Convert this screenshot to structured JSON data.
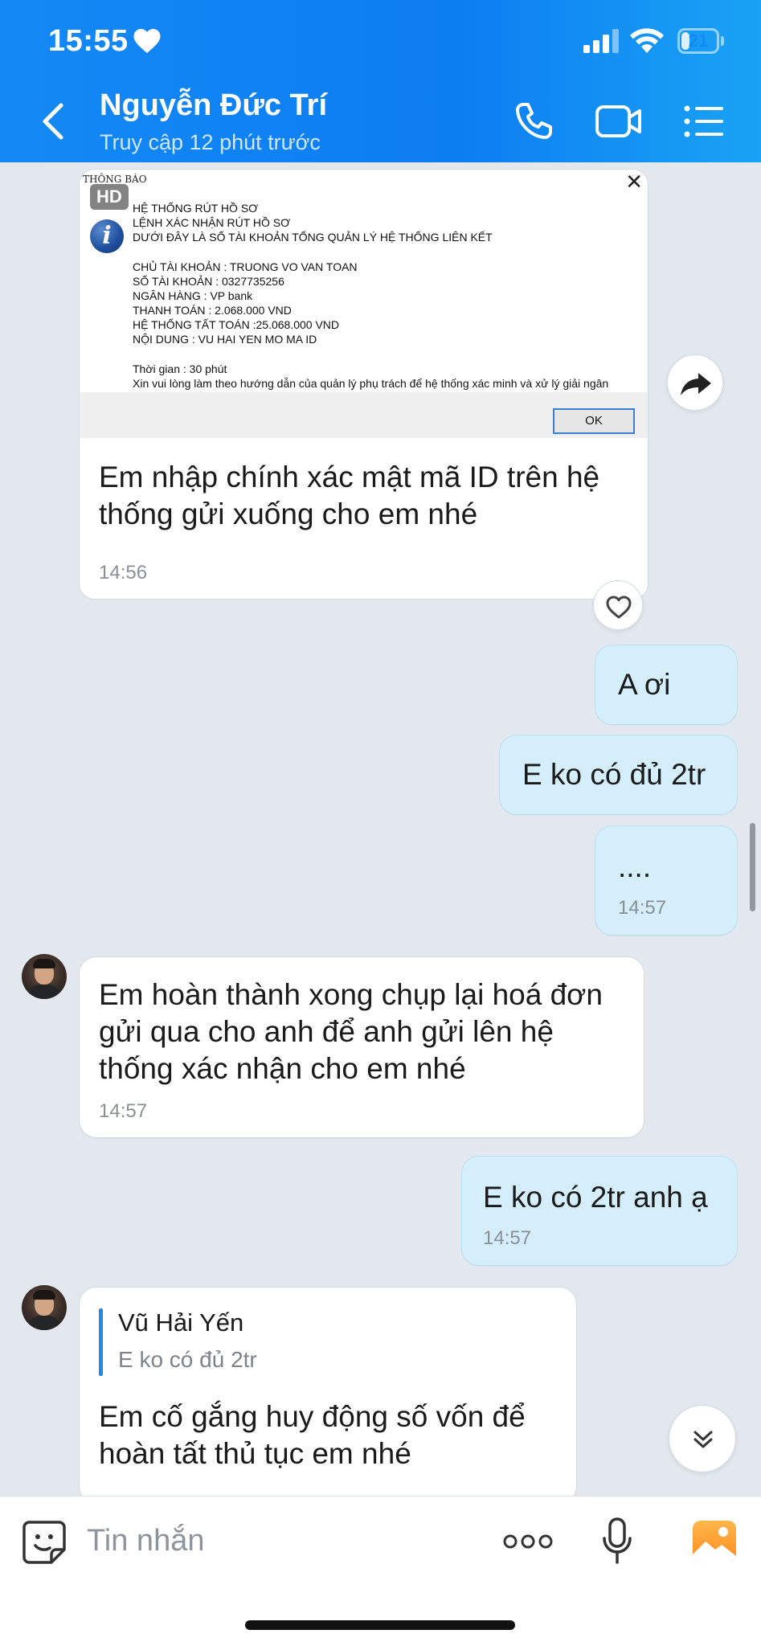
{
  "status_bar": {
    "time": "15:55",
    "battery": "21",
    "battery_level": 0.21
  },
  "header": {
    "contact_name": "Nguyễn Đức Trí",
    "status": "Truy cập 12 phút trước"
  },
  "image_message": {
    "hd_badge": "HD",
    "dialog_title": "THÔNG BÁO",
    "dialog_lines": [
      "HỆ THỐNG RÚT HỒ SƠ",
      "LỆNH XÁC NHẬN RÚT HỒ SƠ",
      "DƯỚI ĐÂY LÀ SỐ TÀI KHOẢN TỔNG QUẢN LÝ HỆ THỐNG LIÊN KẾT",
      "",
      "CHỦ TÀI KHOẢN : TRUONG VO VAN TOAN",
      "SỐ TÀI KHOẢN : 0327735256",
      "NGÂN HÀNG : VP bank",
      "THANH TOÁN : 2.068.000 VND",
      "HỆ THỐNG TẤT TOÁN :25.068.000 VND",
      "NỘI DUNG : VU HAI YEN MO MA ID",
      "",
      "Thời gian : 30 phút",
      "Xin vui lòng làm theo hướng dẫn của quản lý phụ trách để hệ thống xác minh và xử lý giải ngân"
    ],
    "ok_label": "OK",
    "caption": "Em nhập chính xác mật mã ID trên hệ thống gửi xuống cho em nhé",
    "time": "14:56"
  },
  "messages": [
    {
      "text": "A ơi",
      "time": ""
    },
    {
      "text": "E ko có đủ 2tr",
      "time": ""
    },
    {
      "text": "....",
      "time": "14:57"
    },
    {
      "text": "Em hoàn thành xong chụp lại hoá đơn gửi qua cho anh để anh gửi lên hệ thống xác nhận cho em nhé",
      "time": "14:57"
    },
    {
      "text": "E ko có 2tr anh ạ",
      "time": "14:57"
    },
    {
      "reply_name": "Vũ Hải Yến",
      "reply_text": "E ko có đủ 2tr",
      "text": "Em cố gắng huy động số vốn để hoàn tất thủ tục em nhé"
    }
  ],
  "input": {
    "placeholder": "Tin nhắn"
  },
  "colors": {
    "header": "#1489f5",
    "my_bubble": "#d4eefc",
    "background": "#e3e8ef"
  }
}
